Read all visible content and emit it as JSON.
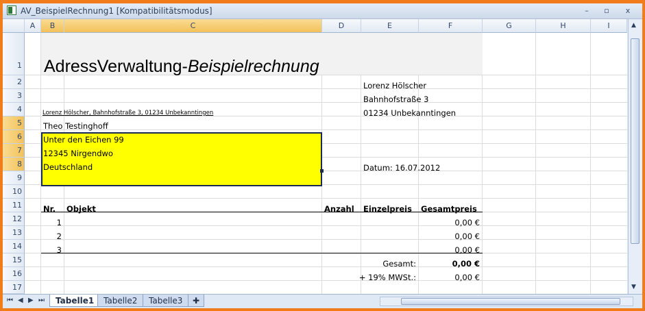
{
  "window": {
    "title": "AV_BeispielRechnung1  [Kompatibilitätsmodus]",
    "minimize": "–",
    "restore": "▫",
    "close": "x"
  },
  "columns": [
    "A",
    "B",
    "C",
    "D",
    "E",
    "F",
    "G",
    "H",
    "I"
  ],
  "rows": [
    "1",
    "2",
    "3",
    "4",
    "5",
    "6",
    "7",
    "8",
    "9",
    "10",
    "11",
    "12",
    "13",
    "14",
    "15",
    "16",
    "17"
  ],
  "sheet": {
    "heading_plain": "AdressVerwaltung-",
    "heading_italic": "Beispielrechnung",
    "sender_name": "Lorenz Hölscher",
    "sender_street": "Bahnhofstraße 3",
    "sender_city": "01234 Unbekanntingen",
    "sender_line": "Lorenz Hölscher, Bahnhofstraße 3, 01234 Unbekanntingen",
    "recipient": [
      "Theo Testinghoff",
      "Unter den Eichen 99",
      "12345 Nirgendwo",
      "Deutschland"
    ],
    "date": "Datum: 16.07.2012",
    "table_headers": {
      "nr": "Nr.",
      "objekt": "Objekt",
      "anzahl": "Anzahl",
      "einzelpreis": "Einzelpreis",
      "gesamtpreis": "Gesamtpreis"
    },
    "items": [
      {
        "nr": "1",
        "gesamt": "0,00 €"
      },
      {
        "nr": "2",
        "gesamt": "0,00 €"
      },
      {
        "nr": "3",
        "gesamt": "0,00 €"
      }
    ],
    "gesamt_label": "Gesamt:",
    "gesamt_value": "0,00 €",
    "mwst_label": "+ 19% MWSt.:",
    "mwst_value": "0,00 €"
  },
  "sheet_tabs": [
    "Tabelle1",
    "Tabelle2",
    "Tabelle3"
  ],
  "active_tab": "Tabelle1"
}
